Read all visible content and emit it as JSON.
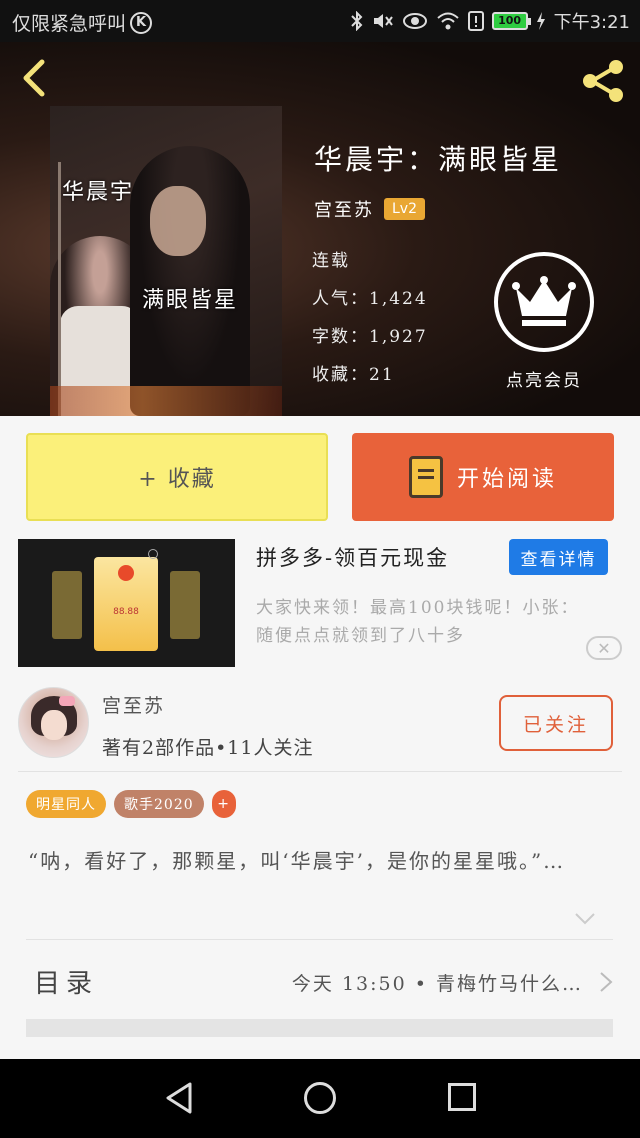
{
  "status_bar": {
    "emergency_text": "仅限紧急呼叫",
    "carrier_icon": "k-circle-icon",
    "battery": "100",
    "time": "下午3:21",
    "icons": [
      "bluetooth-icon",
      "mute-icon",
      "eye-icon",
      "wifi-icon",
      "sim-alert-icon",
      "battery-icon",
      "charging-icon"
    ]
  },
  "header": {
    "back_icon": "chevron-left-icon",
    "share_icon": "share-icon",
    "cover_text_1": "华晨宇",
    "cover_text_2": "满眼皆星",
    "title": "华晨宇：满眼皆星",
    "author": "宫至苏",
    "level": "Lv2",
    "status": "连载",
    "popularity": "人气：1,424",
    "word_count": "字数：1,927",
    "favorites": "收藏：21",
    "vip_icon": "crown-icon",
    "vip_label": "点亮会员"
  },
  "actions": {
    "collect_label": "+ 收藏",
    "read_label": "开始阅读",
    "read_icon": "book-icon"
  },
  "ad": {
    "title": "拼多多-领百元现金",
    "detail_button": "查看详情",
    "description": "大家快来领！最高100块钱呢！小张：随便点点就领到了八十多",
    "image_amount": "88.88",
    "close_icon": "close-icon"
  },
  "author_card": {
    "name": "宫至苏",
    "stats": "著有2部作品•11人关注",
    "follow_label": "已关注"
  },
  "tags": [
    "明星同人",
    "歌手2020",
    "+"
  ],
  "synopsis": "“呐，看好了，那颗星，叫‘华晨宇’，是你的星星哦。”…",
  "toc": {
    "label": "目录",
    "latest": "今天 13:50 • 青梅竹马什么…"
  },
  "colors": {
    "accent_orange": "#e8623a",
    "collect_yellow": "#fbf07a",
    "ad_blue": "#1f7be6",
    "level_gold": "#e9a733"
  }
}
